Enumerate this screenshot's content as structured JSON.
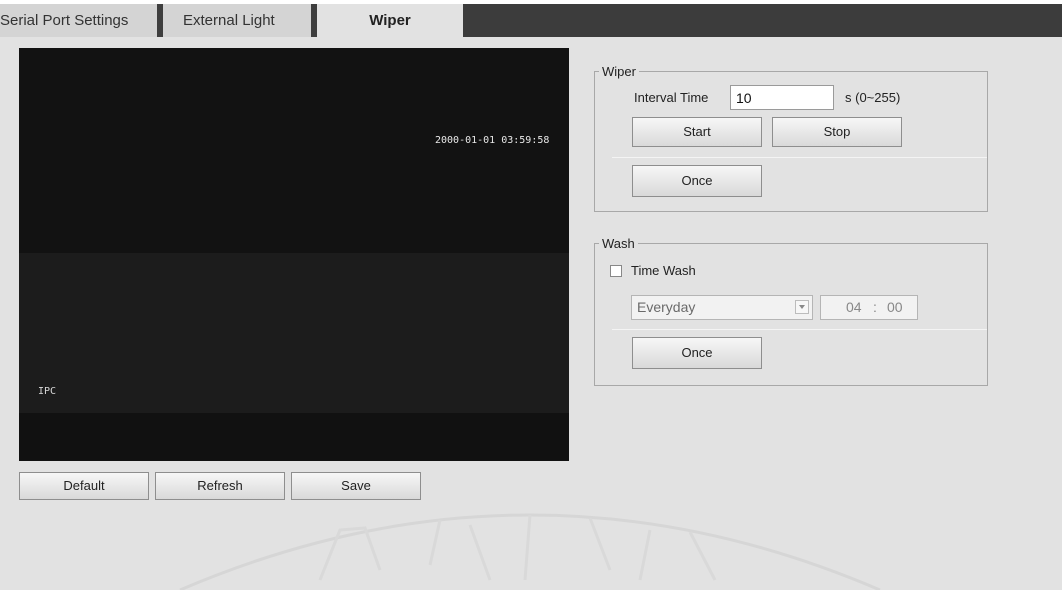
{
  "tabs": [
    {
      "label": "Serial Port Settings"
    },
    {
      "label": "External Light"
    },
    {
      "label": "Wiper",
      "active": true
    }
  ],
  "video": {
    "timestamp": "2000-01-01 03:59:58",
    "channel_label": "IPC"
  },
  "footer_buttons": {
    "default_label": "Default",
    "refresh_label": "Refresh",
    "save_label": "Save"
  },
  "wiper": {
    "legend": "Wiper",
    "interval_label": "Interval Time",
    "interval_value": "10",
    "interval_unit": "s (0~255)",
    "start_label": "Start",
    "stop_label": "Stop",
    "once_label": "Once"
  },
  "wash": {
    "legend": "Wash",
    "time_wash_label": "Time Wash",
    "time_wash_checked": false,
    "schedule_value": "Everyday",
    "hour": "04",
    "separator": ":",
    "minute": "00",
    "once_label": "Once"
  },
  "colors": {
    "background": "#e2e2e2",
    "tab_dark": "#3c3c3c",
    "video_bg": "#151515"
  }
}
